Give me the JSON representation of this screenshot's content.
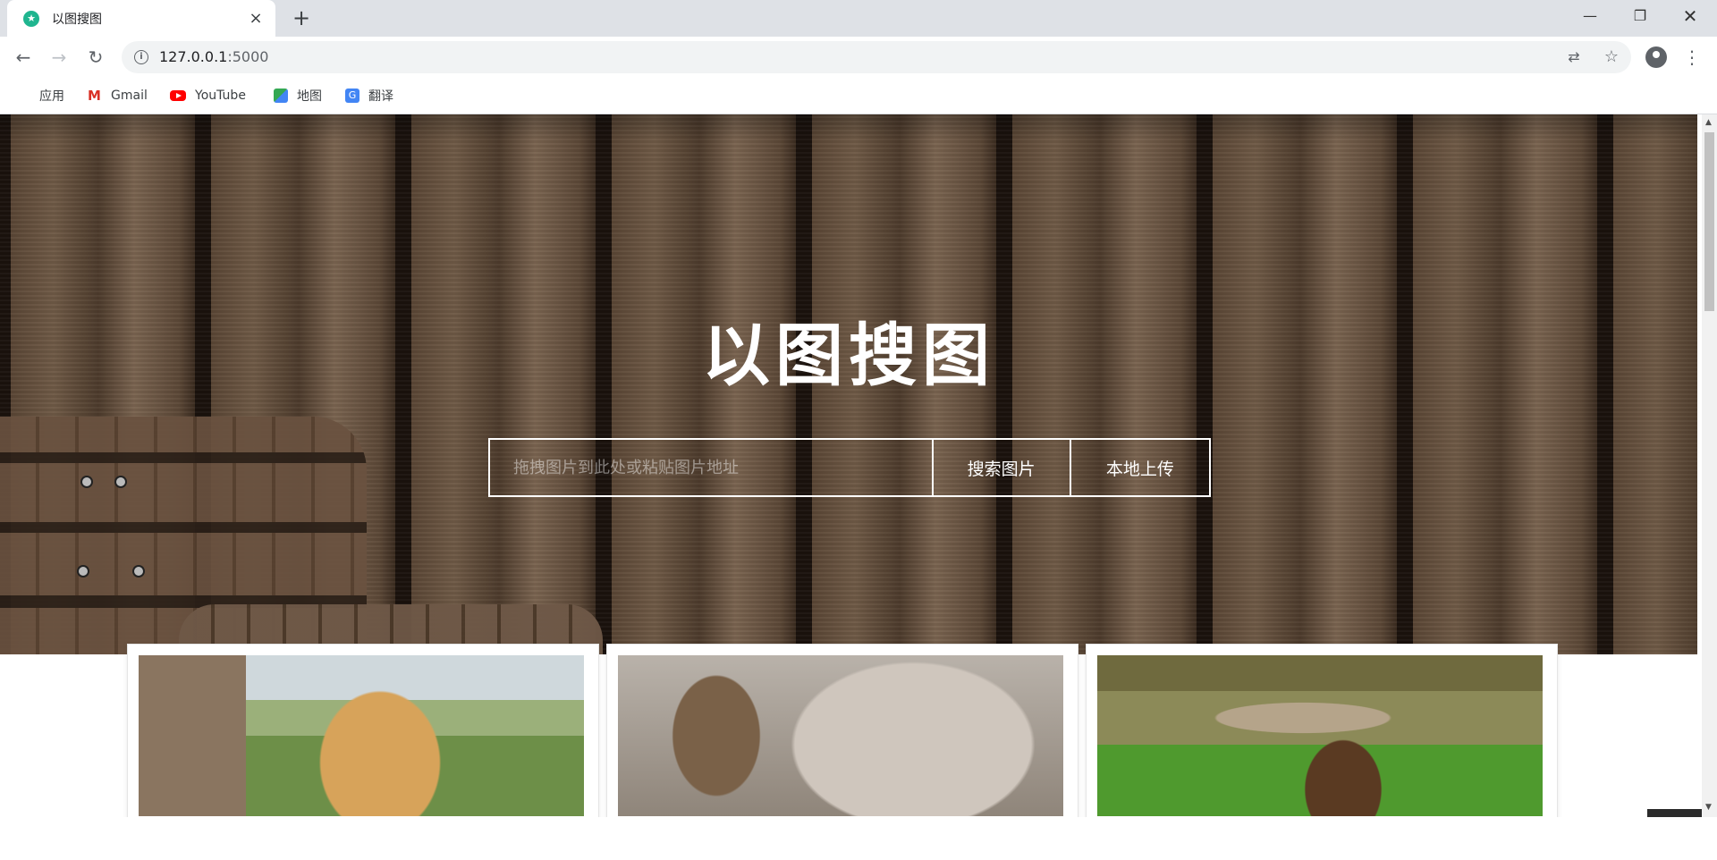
{
  "browser": {
    "tab": {
      "title": "以图搜图"
    },
    "address": {
      "host": "127.0.0.1",
      "port": ":5000"
    },
    "window_controls": {
      "minimize": "—",
      "restore": "❐",
      "close": "✕"
    },
    "bookmarks": [
      {
        "label": "应用",
        "icon": "apps-grid-icon"
      },
      {
        "label": "Gmail",
        "icon": "gmail-icon"
      },
      {
        "label": "YouTube",
        "icon": "youtube-icon"
      },
      {
        "label": "地图",
        "icon": "maps-icon"
      },
      {
        "label": "翻译",
        "icon": "translate-icon"
      }
    ]
  },
  "hero": {
    "title": "以图搜图",
    "search": {
      "placeholder": "拖拽图片到此处或粘贴图片地址",
      "search_label": "搜索图片",
      "upload_label": "本地上传"
    }
  },
  "gallery": {
    "items": [
      {
        "subject": "dog"
      },
      {
        "subject": "cats"
      },
      {
        "subject": "field"
      }
    ]
  },
  "colors": {
    "accent_favicon": "#1fb58f",
    "text": "#202124",
    "hero_text": "#ffffff"
  }
}
